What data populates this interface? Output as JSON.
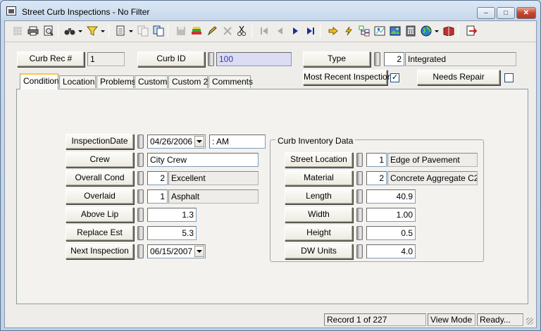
{
  "window": {
    "title": "Street Curb Inspections - No Filter",
    "minimize": "–",
    "maximize": "□",
    "close": "✕"
  },
  "header": {
    "curb_rec_label": "Curb Rec #",
    "curb_rec_value": "1",
    "curb_id_label": "Curb ID",
    "curb_id_value": "100",
    "type_label": "Type",
    "type_code": "2",
    "type_value": "Integrated",
    "most_recent_label": "Most Recent Inspection",
    "most_recent_checked": "✓",
    "needs_repair_label": "Needs Repair",
    "needs_repair_checked": ""
  },
  "tabs": [
    "Condition",
    "Location",
    "Problems",
    "Custom",
    "Custom 2",
    "Comments"
  ],
  "condition": {
    "inspection_date_label": "InspectionDate",
    "inspection_date_value": "04/26/2006",
    "inspection_time_value": ":  AM",
    "crew_label": "Crew",
    "crew_value": "City Crew",
    "overall_cond_label": "Overall Cond",
    "overall_cond_code": "2",
    "overall_cond_value": "Excellent",
    "overlaid_label": "Overlaid",
    "overlaid_code": "1",
    "overlaid_value": "Asphalt",
    "above_lip_label": "Above Lip",
    "above_lip_value": "1.3",
    "replace_est_label": "Replace Est",
    "replace_est_value": "5.3",
    "next_inspection_label": "Next Inspection",
    "next_inspection_value": "06/15/2007"
  },
  "inventory": {
    "group_title": "Curb Inventory Data",
    "street_location_label": "Street Location",
    "street_location_code": "1",
    "street_location_value": "Edge of Pavement",
    "material_label": "Material",
    "material_code": "2",
    "material_value": "Concrete Aggregate C2",
    "length_label": "Length",
    "length_value": "40.9",
    "width_label": "Width",
    "width_value": "1.00",
    "height_label": "Height",
    "height_value": "0.5",
    "dw_units_label": "DW Units",
    "dw_units_value": "4.0"
  },
  "status": {
    "record": "Record 1 of 227",
    "mode": "View Mode",
    "ready": "Ready..."
  },
  "toolbar_icons": [
    "grid-icon",
    "print-icon",
    "print-preview-icon",
    "binoculars-icon",
    "filter-icon",
    "document-icon",
    "copy-icon",
    "export-icon",
    "save-icon",
    "stack-icon",
    "edit-pencil-icon",
    "delete-icon",
    "cut-icon",
    "first-record-icon",
    "previous-record-icon",
    "next-record-icon",
    "last-record-icon",
    "arrow-right-icon",
    "lightning-icon",
    "tree-icon",
    "map-icon",
    "image-icon",
    "calculator-icon",
    "globe-icon",
    "book-icon",
    "exit-icon"
  ],
  "colors": {
    "accent_tab": "#ffc83c",
    "curb_id_bg": "#dcdcf4",
    "curb_id_text": "#3838a8"
  }
}
